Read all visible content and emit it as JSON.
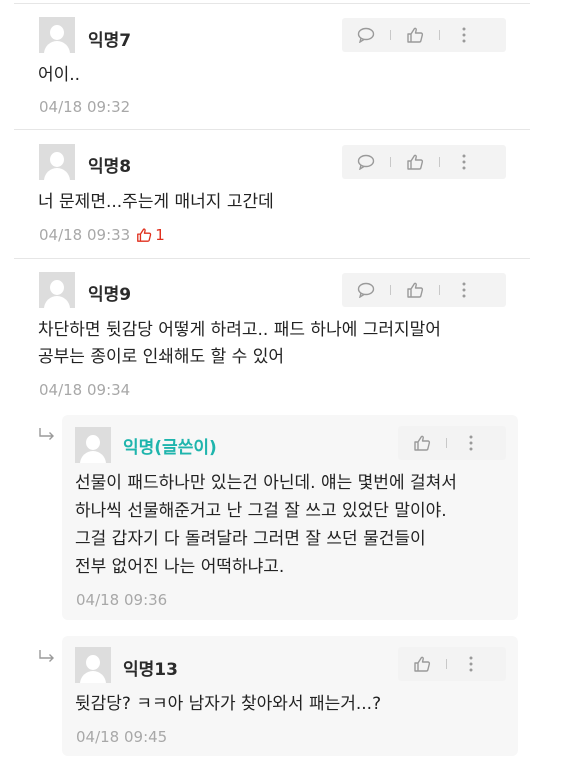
{
  "comments": [
    {
      "nick": "익명7",
      "lines": [
        "어이.."
      ],
      "time": "04/18 09:32",
      "likes": ""
    },
    {
      "nick": "익명8",
      "lines": [
        "너 문제면...주는게 매너지 고간데"
      ],
      "time": "04/18 09:33",
      "likes": "1"
    },
    {
      "nick": "익명9",
      "lines": [
        "차단하면 뒷감당 어떻게 하려고.. 패드 하나에 그러지말어",
        "공부는 종이로 인쇄해도 할 수 있어"
      ],
      "time": "04/18 09:34",
      "likes": ""
    }
  ],
  "replies": [
    {
      "nick": "익명(글쓴이)",
      "lines": [
        "선물이 패드하나만 있는건 아닌데. 얘는 몇번에 걸쳐서",
        "하나씩 선물해준거고 난 그걸 잘 쓰고 있었단 말이야.",
        "그걸 갑자기 다 돌려달라 그러면 잘 쓰던 물건들이",
        "전부 없어진 나는 어떡하냐고."
      ],
      "time": "04/18 09:36"
    },
    {
      "nick": "익명13",
      "lines": [
        "뒷감당? ㅋㅋ아 남자가 찾아와서 패는거...?"
      ],
      "time": "04/18 09:45"
    }
  ],
  "icons": {
    "comment": "speech-bubble-icon",
    "like": "thumbs-up-icon",
    "more": "more-vertical-icon",
    "reply": "reply-arrow-icon",
    "avatar": "default-avatar"
  },
  "colors": {
    "writer_nick": "#1fb5ad",
    "like_count": "#e0301e",
    "action_bg": "#f3f3f3",
    "reply_bg": "#f7f7f7"
  }
}
